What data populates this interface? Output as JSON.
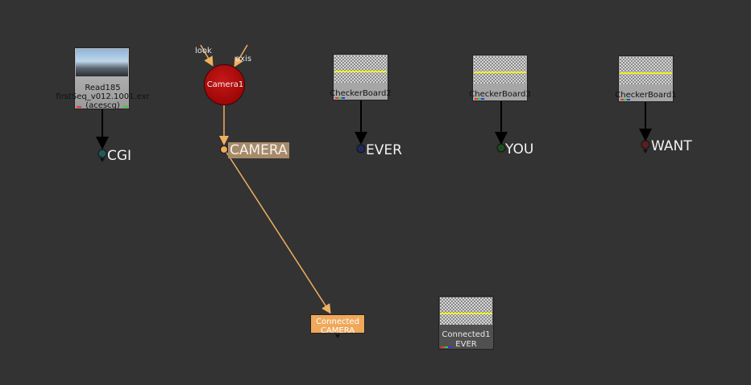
{
  "nodes": {
    "read": {
      "name": "Read185",
      "file": "firstSeq_v012.1001.exr",
      "colorspace": "(acescg)"
    },
    "camera": {
      "name": "Camera1",
      "inputs": [
        "look",
        "axis"
      ]
    },
    "checkerboards": [
      {
        "name": "CheckerBoard2"
      },
      {
        "name": "CheckerBoard3"
      },
      {
        "name": "CheckerBoard1"
      }
    ],
    "dots": [
      {
        "label": "CGI",
        "color": "#1f5a5a"
      },
      {
        "label": "CAMERA",
        "color": "#f0a85a"
      },
      {
        "label": "EVER",
        "color": "#1e2a5c"
      },
      {
        "label": "YOU",
        "color": "#1f4a1f"
      },
      {
        "label": "WANT",
        "color": "#5a1f1f"
      }
    ],
    "connected_camera": {
      "line1": "Connected",
      "line2": "CAMERA"
    },
    "connected1": {
      "name": "Connected1",
      "sub": "EVER"
    }
  },
  "colors": {
    "background": "#333333",
    "camera_pipe": "#f0b060",
    "pipe": "#000000",
    "camera_node": "#b00000",
    "connected_camera_node": "#f0a85a"
  }
}
